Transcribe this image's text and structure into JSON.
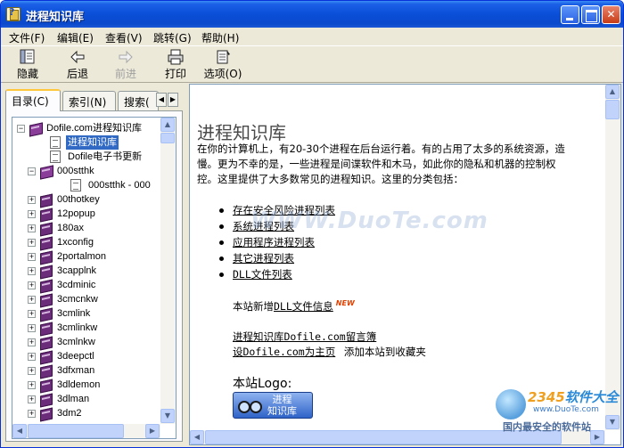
{
  "window": {
    "title": "进程知识库"
  },
  "menu": [
    "文件(F)",
    "编辑(E)",
    "查看(V)",
    "跳转(G)",
    "帮助(H)"
  ],
  "toolbar": {
    "hide": "隐藏",
    "back": "后退",
    "forward": "前进",
    "print": "打印",
    "options": "选项(O)"
  },
  "tabs": {
    "contents": "目录(C)",
    "index": "索引(N)",
    "search": "搜索("
  },
  "tree": [
    {
      "label": "Dofile.com进程知识库",
      "icon": "book-open-icon",
      "expand": "−"
    },
    {
      "label": "进程知识库",
      "icon": "page-icon",
      "selected": true
    },
    {
      "label": "Dofile电子书更新",
      "icon": "page-icon"
    },
    {
      "label": "000stthk",
      "icon": "book-open-icon",
      "expand": "−"
    },
    {
      "label": "000stthk - 000",
      "icon": "page-icon"
    },
    {
      "label": "00thotkey",
      "icon": "book-icon",
      "expand": "+"
    },
    {
      "label": "12popup",
      "icon": "book-icon",
      "expand": "+"
    },
    {
      "label": "180ax",
      "icon": "book-icon",
      "expand": "+"
    },
    {
      "label": "1xconfig",
      "icon": "book-icon",
      "expand": "+"
    },
    {
      "label": "2portalmon",
      "icon": "book-icon",
      "expand": "+"
    },
    {
      "label": "3capplnk",
      "icon": "book-icon",
      "expand": "+"
    },
    {
      "label": "3cdminic",
      "icon": "book-icon",
      "expand": "+"
    },
    {
      "label": "3cmcnkw",
      "icon": "book-icon",
      "expand": "+"
    },
    {
      "label": "3cmlink",
      "icon": "book-icon",
      "expand": "+"
    },
    {
      "label": "3cmlinkw",
      "icon": "book-icon",
      "expand": "+"
    },
    {
      "label": "3cmlnkw",
      "icon": "book-icon",
      "expand": "+"
    },
    {
      "label": "3deepctl",
      "icon": "book-icon",
      "expand": "+"
    },
    {
      "label": "3dfxman",
      "icon": "book-icon",
      "expand": "+"
    },
    {
      "label": "3dldemon",
      "icon": "book-icon",
      "expand": "+"
    },
    {
      "label": "3dlman",
      "icon": "book-icon",
      "expand": "+"
    },
    {
      "label": "3dm2",
      "icon": "book-icon",
      "expand": "+"
    }
  ],
  "content": {
    "title": "进程知识库",
    "intro": [
      "在你的计算机上，有20-30个进程在后台运行着。有的占用了太多的系统资源，造",
      "慢。更为不幸的是，一些进程是间谍软件和木马，如此你的隐私和机器的控制权",
      "控。这里提供了大多数常见的进程知识。这里的分类包括："
    ],
    "links": [
      "存在安全风险进程列表",
      "系统进程列表",
      "应用程序进程列表",
      "其它进程列表",
      "DLL文件列表"
    ],
    "news_prefix": "本站新增",
    "news_link": "DLL文件信息",
    "news_badge": "NEW",
    "guestbook": "进程知识库Dofile.com留言簿",
    "homepage": "设Dofile.com为主页",
    "favorites": "添加本站到收藏夹",
    "logo_label": "本站Logo:",
    "logo_text_1": "进程",
    "logo_text_2": "知识库"
  },
  "watermark": {
    "center": "WWW.DuoTe.com",
    "brand_num": "2345",
    "brand_text": "软件大全",
    "url": "www.DuoTe.com",
    "slogan": "国内最安全的软件站"
  }
}
